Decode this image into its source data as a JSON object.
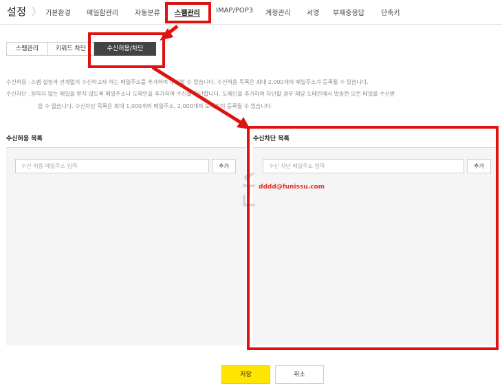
{
  "header": {
    "title": "설정",
    "chevron": "〉",
    "nav": [
      {
        "label": "기본환경"
      },
      {
        "label": "메일함관리"
      },
      {
        "label": "자동분류"
      },
      {
        "label": "스팸관리",
        "active": true
      },
      {
        "label": "IMAP/POP3"
      },
      {
        "label": "계정관리"
      },
      {
        "label": "서명"
      },
      {
        "label": "부재중응답"
      },
      {
        "label": "단축키"
      }
    ]
  },
  "subtabs": [
    {
      "label": "스팸관리"
    },
    {
      "label": "키워드 차단"
    },
    {
      "label": "수신허용/차단",
      "active": true
    }
  ],
  "descriptions": {
    "allow_label": "수신허용 :",
    "allow_text": "스팸 설정과 관계없이 수신하고자 하는 메일주소를 추가하여 수신할 수 있습니다. 수신허용 목록은 최대 2,000개의 메일주소가 등록될 수 있습니다.",
    "block_label": "수신차단 :",
    "block_text_1": "원하지 않는 메일을 받지 않도록 메일주소나 도메인을 추가하여 수신을 차단합니다. 도메인을 추가하여 차단할 경우 해당 도메인에서 발송한 모든 메일을 수신받",
    "block_text_2": "을 수 없습니다. 수신차단 목록은 최대 1,000개의 메일주소, 2,000개의 도메인이 등록될 수 있습니다."
  },
  "allow_list": {
    "title": "수신허용 목록",
    "placeholder": "수신 허용 메일주소 입력",
    "add_label": "추가",
    "entries": []
  },
  "block_list": {
    "title": "수신차단 목록",
    "placeholder": "수신 차단 메일주소 입력",
    "add_label": "추가",
    "entries": [
      "dddd@funissu.com"
    ]
  },
  "footer": {
    "save_label": "저장",
    "cancel_label": "취소"
  },
  "colors": {
    "annotation_red": "#e0120f",
    "save_yellow": "#ffe600",
    "blocked_entry_red": "#e0352b"
  }
}
